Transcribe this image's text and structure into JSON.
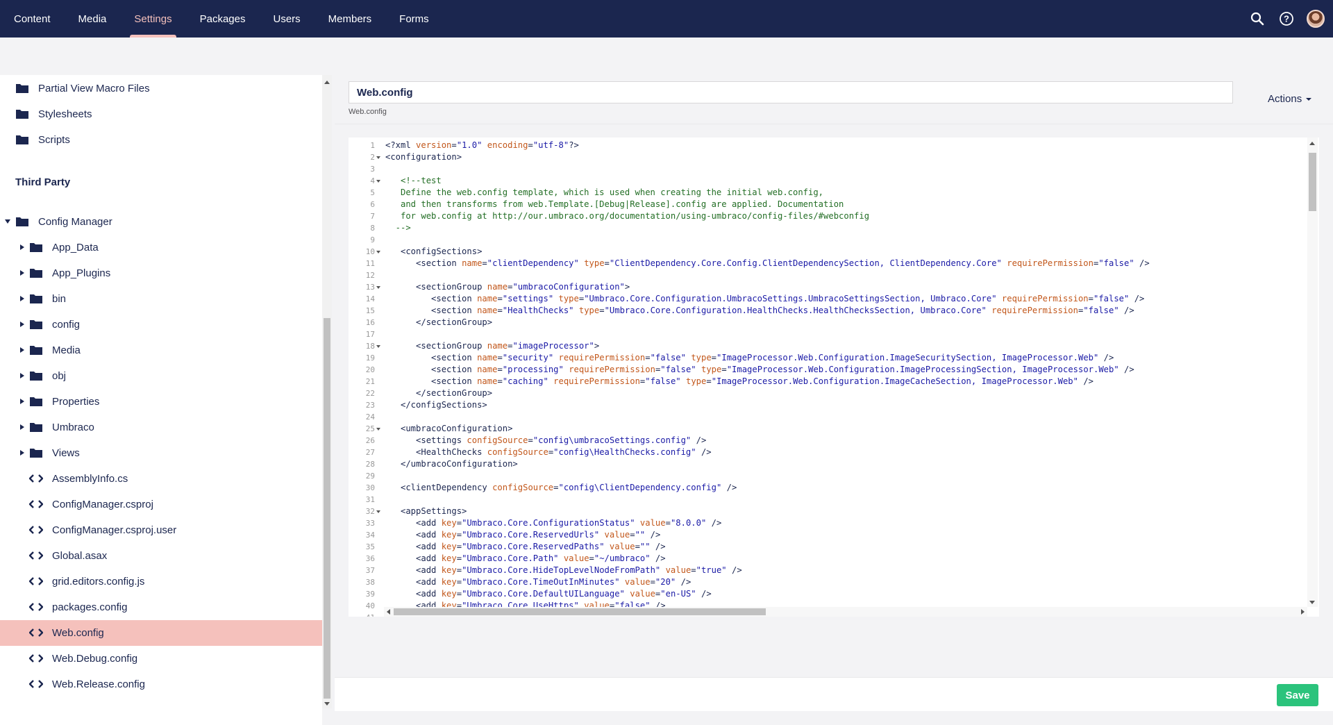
{
  "topnav": {
    "items": [
      {
        "label": "Content"
      },
      {
        "label": "Media"
      },
      {
        "label": "Settings"
      },
      {
        "label": "Packages"
      },
      {
        "label": "Users"
      },
      {
        "label": "Members"
      },
      {
        "label": "Forms"
      }
    ],
    "active": "Settings",
    "icons": [
      "search-icon",
      "help-icon",
      "user-avatar"
    ]
  },
  "sidebar": {
    "items_top": [
      {
        "label": "Partial View Macro Files",
        "icon": "folder-icon"
      },
      {
        "label": "Stylesheets",
        "icon": "folder-icon"
      },
      {
        "label": "Scripts",
        "icon": "folder-icon"
      }
    ],
    "section_heading": "Third Party",
    "root": {
      "label": "Config Manager",
      "icon": "folder-icon",
      "expanded": true
    },
    "folders": [
      {
        "label": "App_Data"
      },
      {
        "label": "App_Plugins"
      },
      {
        "label": "bin"
      },
      {
        "label": "config"
      },
      {
        "label": "Media"
      },
      {
        "label": "obj"
      },
      {
        "label": "Properties"
      },
      {
        "label": "Umbraco"
      },
      {
        "label": "Views"
      }
    ],
    "files": [
      {
        "label": "AssemblyInfo.cs"
      },
      {
        "label": "ConfigManager.csproj"
      },
      {
        "label": "ConfigManager.csproj.user"
      },
      {
        "label": "Global.asax"
      },
      {
        "label": "grid.editors.config.js"
      },
      {
        "label": "packages.config"
      },
      {
        "label": "Web.config"
      },
      {
        "label": "Web.Debug.config"
      },
      {
        "label": "Web.Release.config"
      }
    ],
    "selected": "Web.config"
  },
  "editor": {
    "name_value": "Web.config",
    "alias": "Web.config",
    "actions_label": "Actions",
    "save_label": "Save",
    "lines": [
      [
        [
          "p",
          "<?xml "
        ],
        [
          "a",
          "version"
        ],
        [
          "p",
          "="
        ],
        [
          "v",
          "\"1.0\""
        ],
        [
          "p",
          " "
        ],
        [
          "a",
          "encoding"
        ],
        [
          "p",
          "="
        ],
        [
          "v",
          "\"utf-8\""
        ],
        [
          "p",
          "?>"
        ]
      ],
      [
        [
          "t",
          "<configuration>"
        ]
      ],
      [],
      [
        [
          "c",
          "   <!--test"
        ]
      ],
      [
        [
          "c",
          "   Define the web.config template, which is used when creating the initial web.config,"
        ]
      ],
      [
        [
          "c",
          "   and then transforms from web.Template.[Debug|Release].config are applied. Documentation"
        ]
      ],
      [
        [
          "c",
          "   for web.config at http://our.umbraco.org/documentation/using-umbraco/config-files/#webconfig"
        ]
      ],
      [
        [
          "c",
          "  -->"
        ]
      ],
      [],
      [
        [
          "t",
          "   <configSections>"
        ]
      ],
      [
        [
          "t",
          "      <section "
        ],
        [
          "a",
          "name"
        ],
        [
          "p",
          "="
        ],
        [
          "v",
          "\"clientDependency\""
        ],
        [
          "p",
          " "
        ],
        [
          "a",
          "type"
        ],
        [
          "p",
          "="
        ],
        [
          "v",
          "\"ClientDependency.Core.Config.ClientDependencySection, ClientDependency.Core\""
        ],
        [
          "p",
          " "
        ],
        [
          "a",
          "requirePermission"
        ],
        [
          "p",
          "="
        ],
        [
          "v",
          "\"false\""
        ],
        [
          "t",
          " />"
        ]
      ],
      [],
      [
        [
          "t",
          "      <sectionGroup "
        ],
        [
          "a",
          "name"
        ],
        [
          "p",
          "="
        ],
        [
          "v",
          "\"umbracoConfiguration\""
        ],
        [
          "t",
          ">"
        ]
      ],
      [
        [
          "t",
          "         <section "
        ],
        [
          "a",
          "name"
        ],
        [
          "p",
          "="
        ],
        [
          "v",
          "\"settings\""
        ],
        [
          "p",
          " "
        ],
        [
          "a",
          "type"
        ],
        [
          "p",
          "="
        ],
        [
          "v",
          "\"Umbraco.Core.Configuration.UmbracoSettings.UmbracoSettingsSection, Umbraco.Core\""
        ],
        [
          "p",
          " "
        ],
        [
          "a",
          "requirePermission"
        ],
        [
          "p",
          "="
        ],
        [
          "v",
          "\"false\""
        ],
        [
          "t",
          " />"
        ]
      ],
      [
        [
          "t",
          "         <section "
        ],
        [
          "a",
          "name"
        ],
        [
          "p",
          "="
        ],
        [
          "v",
          "\"HealthChecks\""
        ],
        [
          "p",
          " "
        ],
        [
          "a",
          "type"
        ],
        [
          "p",
          "="
        ],
        [
          "v",
          "\"Umbraco.Core.Configuration.HealthChecks.HealthChecksSection, Umbraco.Core\""
        ],
        [
          "p",
          " "
        ],
        [
          "a",
          "requirePermission"
        ],
        [
          "p",
          "="
        ],
        [
          "v",
          "\"false\""
        ],
        [
          "t",
          " />"
        ]
      ],
      [
        [
          "t",
          "      </sectionGroup>"
        ]
      ],
      [],
      [
        [
          "t",
          "      <sectionGroup "
        ],
        [
          "a",
          "name"
        ],
        [
          "p",
          "="
        ],
        [
          "v",
          "\"imageProcessor\""
        ],
        [
          "t",
          ">"
        ]
      ],
      [
        [
          "t",
          "         <section "
        ],
        [
          "a",
          "name"
        ],
        [
          "p",
          "="
        ],
        [
          "v",
          "\"security\""
        ],
        [
          "p",
          " "
        ],
        [
          "a",
          "requirePermission"
        ],
        [
          "p",
          "="
        ],
        [
          "v",
          "\"false\""
        ],
        [
          "p",
          " "
        ],
        [
          "a",
          "type"
        ],
        [
          "p",
          "="
        ],
        [
          "v",
          "\"ImageProcessor.Web.Configuration.ImageSecuritySection, ImageProcessor.Web\""
        ],
        [
          "t",
          " />"
        ]
      ],
      [
        [
          "t",
          "         <section "
        ],
        [
          "a",
          "name"
        ],
        [
          "p",
          "="
        ],
        [
          "v",
          "\"processing\""
        ],
        [
          "p",
          " "
        ],
        [
          "a",
          "requirePermission"
        ],
        [
          "p",
          "="
        ],
        [
          "v",
          "\"false\""
        ],
        [
          "p",
          " "
        ],
        [
          "a",
          "type"
        ],
        [
          "p",
          "="
        ],
        [
          "v",
          "\"ImageProcessor.Web.Configuration.ImageProcessingSection, ImageProcessor.Web\""
        ],
        [
          "t",
          " />"
        ]
      ],
      [
        [
          "t",
          "         <section "
        ],
        [
          "a",
          "name"
        ],
        [
          "p",
          "="
        ],
        [
          "v",
          "\"caching\""
        ],
        [
          "p",
          " "
        ],
        [
          "a",
          "requirePermission"
        ],
        [
          "p",
          "="
        ],
        [
          "v",
          "\"false\""
        ],
        [
          "p",
          " "
        ],
        [
          "a",
          "type"
        ],
        [
          "p",
          "="
        ],
        [
          "v",
          "\"ImageProcessor.Web.Configuration.ImageCacheSection, ImageProcessor.Web\""
        ],
        [
          "t",
          " />"
        ]
      ],
      [
        [
          "t",
          "      </sectionGroup>"
        ]
      ],
      [
        [
          "t",
          "   </configSections>"
        ]
      ],
      [],
      [
        [
          "t",
          "   <umbracoConfiguration>"
        ]
      ],
      [
        [
          "t",
          "      <settings "
        ],
        [
          "a",
          "configSource"
        ],
        [
          "p",
          "="
        ],
        [
          "v",
          "\"config\\umbracoSettings.config\""
        ],
        [
          "t",
          " />"
        ]
      ],
      [
        [
          "t",
          "      <HealthChecks "
        ],
        [
          "a",
          "configSource"
        ],
        [
          "p",
          "="
        ],
        [
          "v",
          "\"config\\HealthChecks.config\""
        ],
        [
          "t",
          " />"
        ]
      ],
      [
        [
          "t",
          "   </umbracoConfiguration>"
        ]
      ],
      [],
      [
        [
          "t",
          "   <clientDependency "
        ],
        [
          "a",
          "configSource"
        ],
        [
          "p",
          "="
        ],
        [
          "v",
          "\"config\\ClientDependency.config\""
        ],
        [
          "t",
          " />"
        ]
      ],
      [],
      [
        [
          "t",
          "   <appSettings>"
        ]
      ],
      [
        [
          "t",
          "      <add "
        ],
        [
          "a",
          "key"
        ],
        [
          "p",
          "="
        ],
        [
          "v",
          "\"Umbraco.Core.ConfigurationStatus\""
        ],
        [
          "p",
          " "
        ],
        [
          "a",
          "value"
        ],
        [
          "p",
          "="
        ],
        [
          "v",
          "\"8.0.0\""
        ],
        [
          "t",
          " />"
        ]
      ],
      [
        [
          "t",
          "      <add "
        ],
        [
          "a",
          "key"
        ],
        [
          "p",
          "="
        ],
        [
          "v",
          "\"Umbraco.Core.ReservedUrls\""
        ],
        [
          "p",
          " "
        ],
        [
          "a",
          "value"
        ],
        [
          "p",
          "="
        ],
        [
          "v",
          "\"\""
        ],
        [
          "t",
          " />"
        ]
      ],
      [
        [
          "t",
          "      <add "
        ],
        [
          "a",
          "key"
        ],
        [
          "p",
          "="
        ],
        [
          "v",
          "\"Umbraco.Core.ReservedPaths\""
        ],
        [
          "p",
          " "
        ],
        [
          "a",
          "value"
        ],
        [
          "p",
          "="
        ],
        [
          "v",
          "\"\""
        ],
        [
          "t",
          " />"
        ]
      ],
      [
        [
          "t",
          "      <add "
        ],
        [
          "a",
          "key"
        ],
        [
          "p",
          "="
        ],
        [
          "v",
          "\"Umbraco.Core.Path\""
        ],
        [
          "p",
          " "
        ],
        [
          "a",
          "value"
        ],
        [
          "p",
          "="
        ],
        [
          "v",
          "\"~/umbraco\""
        ],
        [
          "t",
          " />"
        ]
      ],
      [
        [
          "t",
          "      <add "
        ],
        [
          "a",
          "key"
        ],
        [
          "p",
          "="
        ],
        [
          "v",
          "\"Umbraco.Core.HideTopLevelNodeFromPath\""
        ],
        [
          "p",
          " "
        ],
        [
          "a",
          "value"
        ],
        [
          "p",
          "="
        ],
        [
          "v",
          "\"true\""
        ],
        [
          "t",
          " />"
        ]
      ],
      [
        [
          "t",
          "      <add "
        ],
        [
          "a",
          "key"
        ],
        [
          "p",
          "="
        ],
        [
          "v",
          "\"Umbraco.Core.TimeOutInMinutes\""
        ],
        [
          "p",
          " "
        ],
        [
          "a",
          "value"
        ],
        [
          "p",
          "="
        ],
        [
          "v",
          "\"20\""
        ],
        [
          "t",
          " />"
        ]
      ],
      [
        [
          "t",
          "      <add "
        ],
        [
          "a",
          "key"
        ],
        [
          "p",
          "="
        ],
        [
          "v",
          "\"Umbraco.Core.DefaultUILanguage\""
        ],
        [
          "p",
          " "
        ],
        [
          "a",
          "value"
        ],
        [
          "p",
          "="
        ],
        [
          "v",
          "\"en-US\""
        ],
        [
          "t",
          " />"
        ]
      ],
      [
        [
          "t",
          "      <add "
        ],
        [
          "a",
          "key"
        ],
        [
          "p",
          "="
        ],
        [
          "v",
          "\"Umbraco.Core.UseHttps\""
        ],
        [
          "p",
          " "
        ],
        [
          "a",
          "value"
        ],
        [
          "p",
          "="
        ],
        [
          "v",
          "\"false\""
        ],
        [
          "t",
          " />"
        ]
      ],
      []
    ],
    "fold_lines": [
      2,
      4,
      10,
      13,
      18,
      25,
      32
    ]
  },
  "colors": {
    "topbar_bg": "#1b264f",
    "active_nav": "#f5c1bc",
    "selected_item_bg": "#f5c1bc",
    "save_button": "#2bc37c"
  }
}
